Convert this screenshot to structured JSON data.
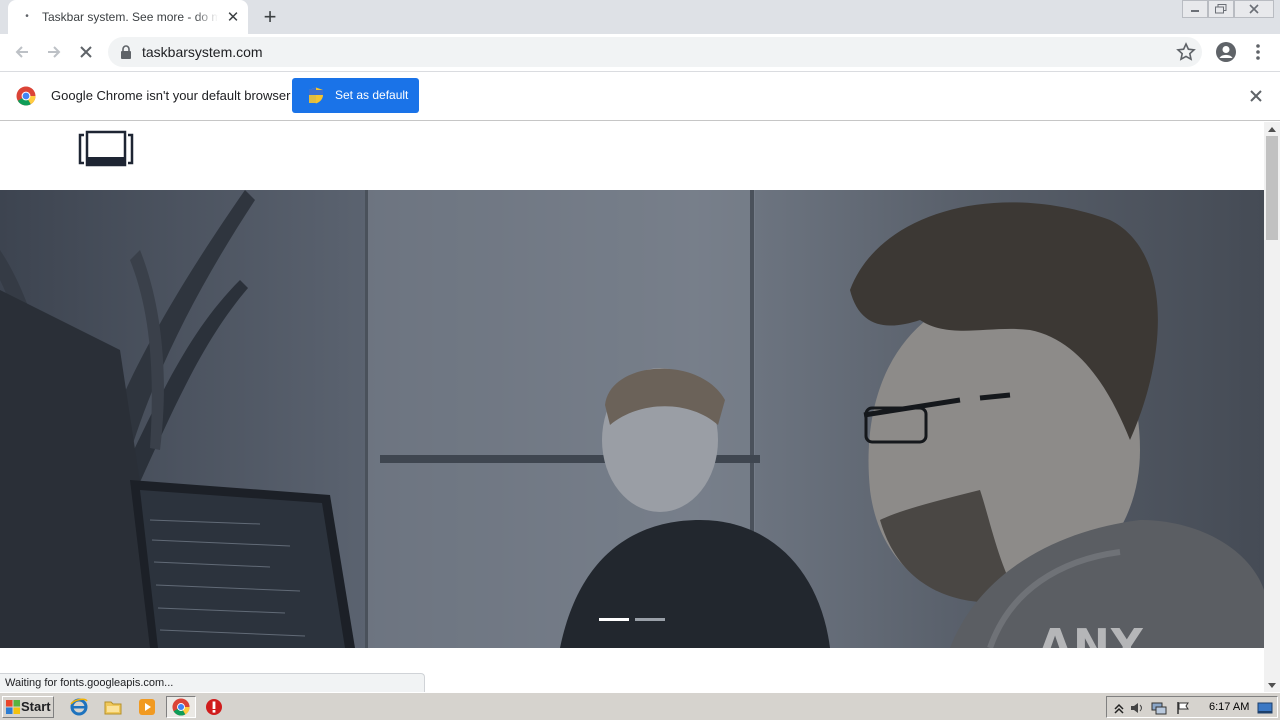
{
  "browser": {
    "tab": {
      "title": "Taskbar system. See more - do more"
    },
    "address": {
      "url": "taskbarsystem.com"
    },
    "infobar": {
      "message": "Google Chrome isn't your default browser",
      "button_label": "Set as default"
    },
    "status_text": "Waiting for fonts.googleapis.com..."
  },
  "page": {
    "hero": {
      "slides_total": 2,
      "active_slide": 1
    },
    "watermark": "ANY RUN"
  },
  "taskbar": {
    "start_label": "Start",
    "clock": "6:17 AM",
    "apps": [
      "internet-explorer-icon",
      "file-explorer-icon",
      "media-player-icon",
      "chrome-icon",
      "stop-sign-icon"
    ]
  },
  "colors": {
    "accent": "#1a73e8",
    "tabstrip": "#dee1e6",
    "taskbar": "#d6d3ce"
  }
}
